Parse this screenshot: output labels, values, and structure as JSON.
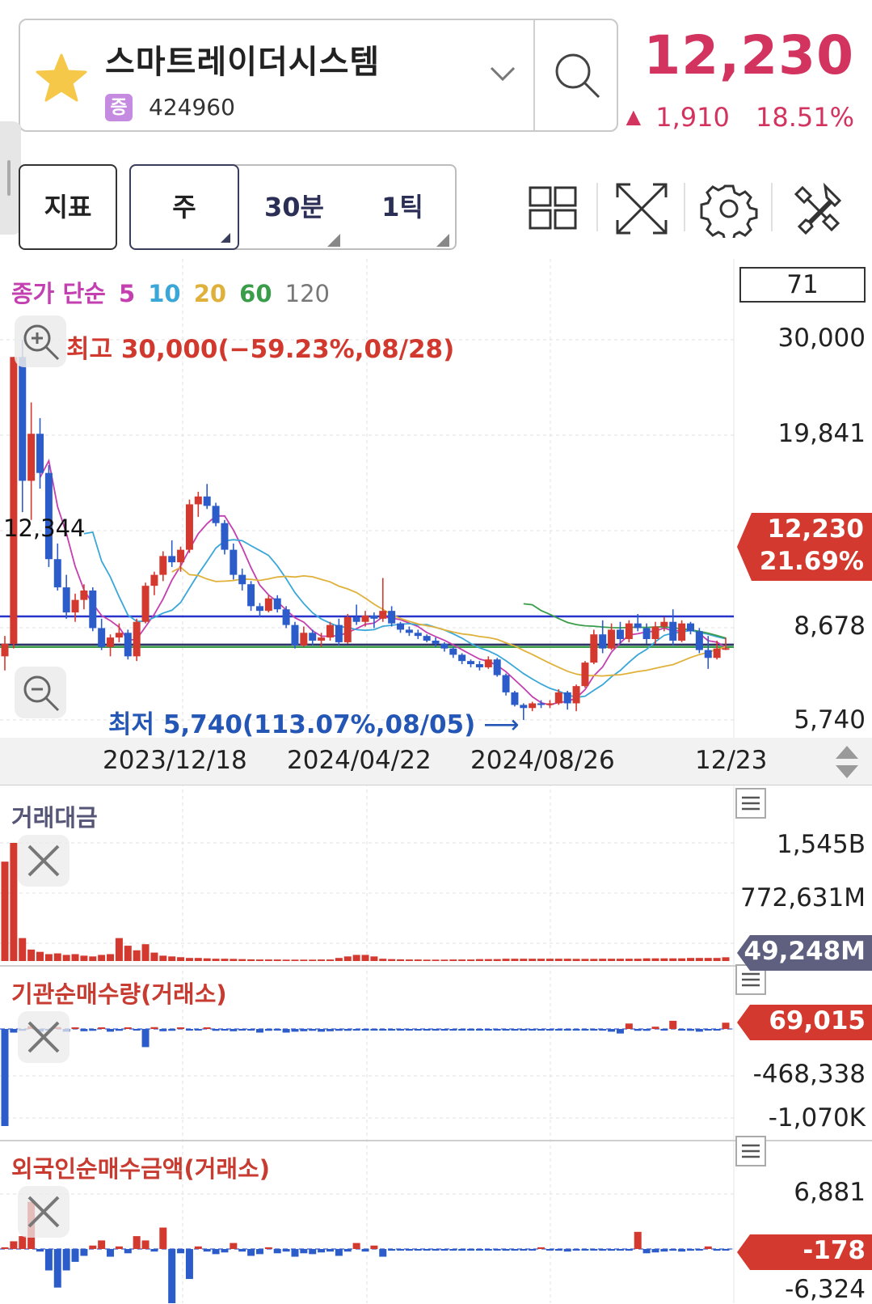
{
  "header": {
    "stock_name": "스마트레이더시스템",
    "market_badge": "증",
    "stock_code": "424960",
    "price": "12,230",
    "change_arrow": "▲",
    "change_amount": "1,910",
    "change_percent": "18.51%",
    "favorite_icon": "star-icon",
    "colors": {
      "up": "#d3335f",
      "down": "#2050c8",
      "star": "#f5c84a"
    }
  },
  "toolbar": {
    "indicator_label": "지표",
    "period_labels": [
      "주",
      "30분",
      "1틱"
    ],
    "selected_period": "주",
    "tools": [
      "grid-layout-icon",
      "fullscreen-icon",
      "gear-icon",
      "tools-icon"
    ]
  },
  "main_chart": {
    "ma_title": "종가 단순",
    "ma_periods": [
      {
        "label": "5",
        "color": "#c43fb0"
      },
      {
        "label": "10",
        "color": "#3aa7d8"
      },
      {
        "label": "20",
        "color": "#e0b13a"
      },
      {
        "label": "60",
        "color": "#3a9d4a"
      },
      {
        "label": "120",
        "color": "#777777"
      }
    ],
    "bar_count_box": "71",
    "high_label": "최고 30,000(−59.23%,08/28)",
    "low_label": "최저 5,740(113.07%,08/05)",
    "left_price_label": "12,344",
    "y_ticks": [
      "30,000",
      "19,841",
      "8,678",
      "5,740"
    ],
    "current_price_tag": "12,230",
    "current_change_tag": "21.69%",
    "x_ticks": [
      "2023/12/18",
      "2024/04/22",
      "2024/08/26",
      "12/23"
    ]
  },
  "chart_data": {
    "type": "candlestick",
    "ylim": [
      5740,
      30000
    ],
    "candles": [
      [
        9800,
        11100,
        8900,
        10600
      ],
      [
        10600,
        28900,
        10300,
        28900
      ],
      [
        28900,
        30000,
        19000,
        21000
      ],
      [
        21000,
        26000,
        18500,
        24000
      ],
      [
        24000,
        25000,
        20500,
        21500
      ],
      [
        21500,
        22000,
        15500,
        16000
      ],
      [
        16000,
        17000,
        14000,
        14200
      ],
      [
        14200,
        15000,
        12200,
        12600
      ],
      [
        12600,
        13800,
        12000,
        13400
      ],
      [
        13400,
        14400,
        12800,
        14000
      ],
      [
        14000,
        14200,
        11400,
        11600
      ],
      [
        11600,
        12200,
        10200,
        10400
      ],
      [
        10400,
        11200,
        9800,
        11000
      ],
      [
        11000,
        11900,
        10700,
        11300
      ],
      [
        11300,
        11500,
        9600,
        9800
      ],
      [
        9800,
        12200,
        9500,
        12000
      ],
      [
        12000,
        14500,
        11900,
        14300
      ],
      [
        14300,
        15200,
        13700,
        15000
      ],
      [
        15000,
        16500,
        14600,
        16200
      ],
      [
        16200,
        17200,
        15500,
        15800
      ],
      [
        15800,
        16800,
        15200,
        16600
      ],
      [
        16600,
        19800,
        16400,
        19500
      ],
      [
        19500,
        20300,
        18700,
        20000
      ],
      [
        20000,
        20800,
        19200,
        19400
      ],
      [
        19400,
        19600,
        18100,
        18300
      ],
      [
        18300,
        18500,
        16300,
        16600
      ],
      [
        16600,
        17000,
        14700,
        15000
      ],
      [
        15000,
        15400,
        14000,
        14400
      ],
      [
        14400,
        14600,
        12700,
        13000
      ],
      [
        13000,
        13200,
        12300,
        12700
      ],
      [
        12700,
        13700,
        12600,
        13500
      ],
      [
        13500,
        13700,
        12600,
        12800
      ],
      [
        12800,
        13000,
        11600,
        11800
      ],
      [
        11800,
        12000,
        10300,
        10500
      ],
      [
        10500,
        11700,
        10400,
        11300
      ],
      [
        11300,
        11500,
        10500,
        10800
      ],
      [
        10800,
        11300,
        10400,
        11000
      ],
      [
        11000,
        12000,
        10800,
        11800
      ],
      [
        11800,
        12200,
        10500,
        10700
      ],
      [
        10700,
        12500,
        10600,
        12300
      ],
      [
        12300,
        13100,
        11800,
        12000
      ],
      [
        12000,
        12700,
        11700,
        12400
      ],
      [
        12400,
        12600,
        11600,
        12200
      ],
      [
        12200,
        14800,
        12000,
        12700
      ],
      [
        12700,
        13000,
        11700,
        11900
      ],
      [
        11900,
        12000,
        11300,
        11500
      ],
      [
        11500,
        11700,
        11100,
        11300
      ],
      [
        11300,
        11500,
        10900,
        11100
      ],
      [
        11100,
        11200,
        10700,
        10800
      ],
      [
        10800,
        11000,
        10400,
        10600
      ],
      [
        10600,
        10700,
        10100,
        10300
      ],
      [
        10300,
        10400,
        9700,
        9900
      ],
      [
        9900,
        10000,
        9300,
        9500
      ],
      [
        9500,
        9600,
        9100,
        9300
      ],
      [
        9300,
        9500,
        8900,
        9100
      ],
      [
        9100,
        9800,
        9000,
        9600
      ],
      [
        9600,
        9700,
        8500,
        8600
      ],
      [
        8600,
        8700,
        7300,
        7500
      ],
      [
        7500,
        7600,
        6600,
        6700
      ],
      [
        6700,
        6800,
        5740,
        6500
      ],
      [
        6500,
        6900,
        6300,
        6800
      ],
      [
        6800,
        7000,
        6500,
        6700
      ],
      [
        6700,
        7000,
        6500,
        6800
      ],
      [
        6800,
        7700,
        6700,
        7500
      ],
      [
        7500,
        7600,
        6400,
        6800
      ],
      [
        6800,
        8000,
        6300,
        7900
      ],
      [
        7900,
        9500,
        7800,
        9400
      ],
      [
        9400,
        11500,
        9300,
        11200
      ],
      [
        11200,
        12100,
        10000,
        10300
      ],
      [
        10300,
        11900,
        10200,
        11500
      ],
      [
        11500,
        12000,
        10600,
        10900
      ],
      [
        10900,
        12100,
        10700,
        11900
      ],
      [
        11900,
        12500,
        11400,
        11600
      ],
      [
        11600,
        11900,
        10600,
        10900
      ],
      [
        10900,
        12000,
        10600,
        11700
      ],
      [
        11700,
        12300,
        11400,
        12000
      ],
      [
        12000,
        12800,
        10500,
        10800
      ],
      [
        10800,
        12100,
        10700,
        11900
      ],
      [
        11900,
        12000,
        11200,
        11400
      ],
      [
        11400,
        11600,
        10000,
        10200
      ],
      [
        10200,
        11100,
        9000,
        9700
      ],
      [
        9700,
        10800,
        9600,
        10300
      ],
      [
        10300,
        11000,
        10200,
        10320
      ]
    ],
    "hlines": [
      {
        "value": 12344,
        "color": "#2733c9"
      },
      {
        "value": 10550,
        "color": "#2e3468"
      },
      {
        "value": 10400,
        "color": "#3a9d4a"
      }
    ]
  },
  "sub_panels": [
    {
      "title": "거래대금",
      "title_color": "#555577",
      "y_ticks": [
        "1,545B",
        "772,631M"
      ],
      "current_tag": "49,248M",
      "tag_color": "#5a5a7a",
      "bars": [
        1300,
        1545,
        300,
        150,
        120,
        90,
        100,
        80,
        90,
        70,
        60,
        80,
        90,
        300,
        200,
        140,
        220,
        110,
        70,
        60,
        50,
        40,
        40,
        35,
        30,
        30,
        28,
        25,
        22,
        20,
        20,
        20,
        18,
        18,
        18,
        18,
        20,
        20,
        40,
        60,
        80,
        80,
        60,
        30,
        25,
        22,
        20,
        20,
        18,
        18,
        18,
        20,
        20,
        20,
        25,
        25,
        25,
        30,
        30,
        30,
        30,
        30,
        30,
        30,
        30,
        28,
        28,
        28,
        30,
        30,
        30,
        30,
        30,
        35,
        35,
        35,
        35,
        35,
        40,
        40,
        40,
        40,
        49
      ]
    },
    {
      "title": "기관순매수량(거래소)",
      "title_color": "#c83b31",
      "y_ticks": [
        "-468,338",
        "-1,070K"
      ],
      "current_tag": "69,015",
      "tag_color": "#d3392f",
      "bars": [
        -1070000,
        -40000,
        -20000,
        30000,
        -30000,
        -15000,
        20000,
        -30000,
        10000,
        -25000,
        -20000,
        15000,
        -30000,
        -20000,
        10000,
        -15000,
        -200000,
        20000,
        -25000,
        -20000,
        15000,
        -15000,
        -10000,
        15000,
        -20000,
        -18000,
        -25000,
        -15000,
        -12000,
        -40000,
        -20000,
        -15000,
        -40000,
        -30000,
        -25000,
        -20000,
        -30000,
        -25000,
        -20000,
        -20000,
        -15000,
        -10000,
        -15000,
        -12000,
        -10000,
        -15000,
        -10000,
        -12000,
        -10000,
        -8000,
        -12000,
        -10000,
        -15000,
        -10000,
        -8000,
        -10000,
        -8000,
        -12000,
        -8000,
        -10000,
        -8000,
        -6000,
        -10000,
        -8000,
        -6000,
        -8000,
        -10000,
        -6000,
        -8000,
        -30000,
        -50000,
        60000,
        -20000,
        -20000,
        25000,
        -10000,
        90000,
        -15000,
        -20000,
        -30000,
        -15000,
        -15000,
        69015
      ]
    },
    {
      "title": "외국인순매수금액(거래소)",
      "title_color": "#c83b31",
      "y_ticks": [
        "6,881",
        "-6,324"
      ],
      "current_tag": "-178",
      "tag_color": "#d3392f",
      "bars": [
        200,
        900,
        1500,
        5500,
        -300,
        -2500,
        -4500,
        -2500,
        -1500,
        -800,
        400,
        1000,
        -900,
        300,
        -500,
        1500,
        1000,
        -300,
        2500,
        -6324,
        -500,
        -3500,
        300,
        -300,
        -600,
        -400,
        700,
        -300,
        -800,
        -600,
        200,
        -500,
        -300,
        -900,
        -500,
        -600,
        -400,
        -300,
        -800,
        -300,
        700,
        -300,
        400,
        -900,
        -200,
        -150,
        -200,
        -150,
        -100,
        -180,
        -120,
        -150,
        -200,
        -150,
        -100,
        -150,
        -100,
        -200,
        -150,
        -100,
        -150,
        200,
        -150,
        -200,
        -300,
        -150,
        -100,
        -150,
        -200,
        -200,
        -100,
        -200,
        2000,
        -500,
        -400,
        -300,
        -200,
        -300,
        -200,
        -150,
        300,
        -200,
        -178
      ]
    }
  ]
}
